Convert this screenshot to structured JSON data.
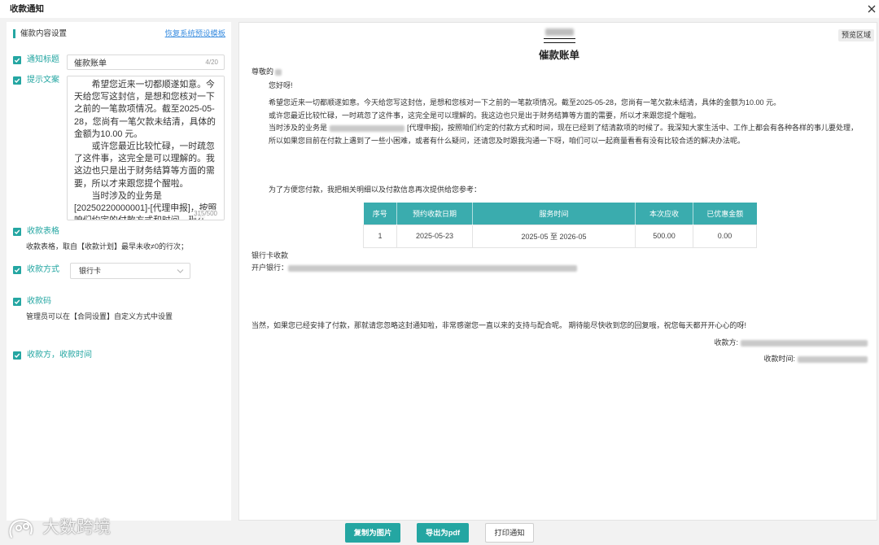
{
  "window": {
    "title": "收款通知",
    "close_icon": "close-icon"
  },
  "settings": {
    "section_title": "催款内容设置",
    "restore_link": "恢复系统预设模板",
    "notice_title": {
      "label": "通知标题",
      "checked": true,
      "value": "催款账单",
      "counter": "4/20"
    },
    "prompt_text": {
      "label": "提示文案",
      "checked": true,
      "value": "　　希望您近来一切都顺遂如意。今天给您写这封信，是想和您核对一下之前的一笔款项情况。截至2025-05-28，您尚有一笔欠款未结清，具体的金额为10.00 元。\n　　或许您最近比较忙碌，一时疏忽了这件事，这完全是可以理解的。我这边也只是出于财务结算等方面的需要，所以才来跟您提个醒啦。\n　　当时涉及的业务是[20250220000001]-[代理申报]，按照咱们约定的付款方式和时间，现在",
      "counter": "315/500"
    },
    "payment_table": {
      "label": "收款表格",
      "checked": true,
      "description": "收款表格，取自【收款计划】最早未收≠0的行次；"
    },
    "payment_method": {
      "label": "收款方式",
      "checked": true,
      "selected": "银行卡",
      "arrow_icon": "chevron-down-icon"
    },
    "payment_code": {
      "label": "收款码",
      "checked": true,
      "description": "管理员可以在【合同设置】自定义方式中设置"
    },
    "payee_and_time": {
      "label": "收款方，收款时间",
      "checked": true
    }
  },
  "preview": {
    "tag": "预览区域",
    "title": "催款账单",
    "salutation": "尊敬的",
    "greeting": "您好呀!",
    "paragraph_1": "希望您近来一切都顺遂如意。今天给您写这封信，是想和您核对一下之前的一笔款项情况。截至2025-05-28，您尚有一笔欠款未结清，具体的金额为10.00 元。",
    "paragraph_2": "或许您最近比较忙碌，一时疏忽了这件事，这完全是可以理解的。我这边也只是出于财务结算等方面的需要，所以才来跟您提个醒啦。",
    "business_prefix": "当时涉及的业务是",
    "business_suffix": "[代理申报]，按照咱们约定的付款方式和时间，现在已经到了结清款项的时候了。我深知大家生活中、工作上都会有各种各样的事儿要处理，",
    "paragraph_4": "所以如果您目前在付款上遇到了一些小困难，或者有什么疑问，还请您及时跟我沟通一下呀，咱们可以一起商量看看有没有比较合适的解决办法呢。",
    "table_intro": "为了方便您付款，我把相关明细以及付款信息再次提供给您参考：",
    "table": {
      "headers": [
        "序号",
        "预约收款日期",
        "服务时间",
        "本次应收",
        "已优惠金额"
      ],
      "rows": [
        [
          "1",
          "2025-05-23",
          "2025-05 至 2026-05",
          "500.00",
          "0.00"
        ]
      ]
    },
    "bank_heading": "银行卡收款",
    "bank_label": "开户银行：",
    "closing": "当然，如果您已经安排了付款，那就请您忽略这封通知啦，非常感谢您一直以来的支持与配合呢。 期待能尽快收到您的回复哦，祝您每天都开开心心的呀!",
    "payee_label": "收款方:",
    "time_label": "收款时间:"
  },
  "actions": {
    "copy_image": "复制为图片",
    "export_pdf": "导出为pdf",
    "print": "打印通知"
  },
  "watermark": {
    "text": "大数跨境"
  },
  "colors": {
    "accent": "#24a6a2",
    "table_header": "#3aacae",
    "link": "#3b8ee0"
  }
}
